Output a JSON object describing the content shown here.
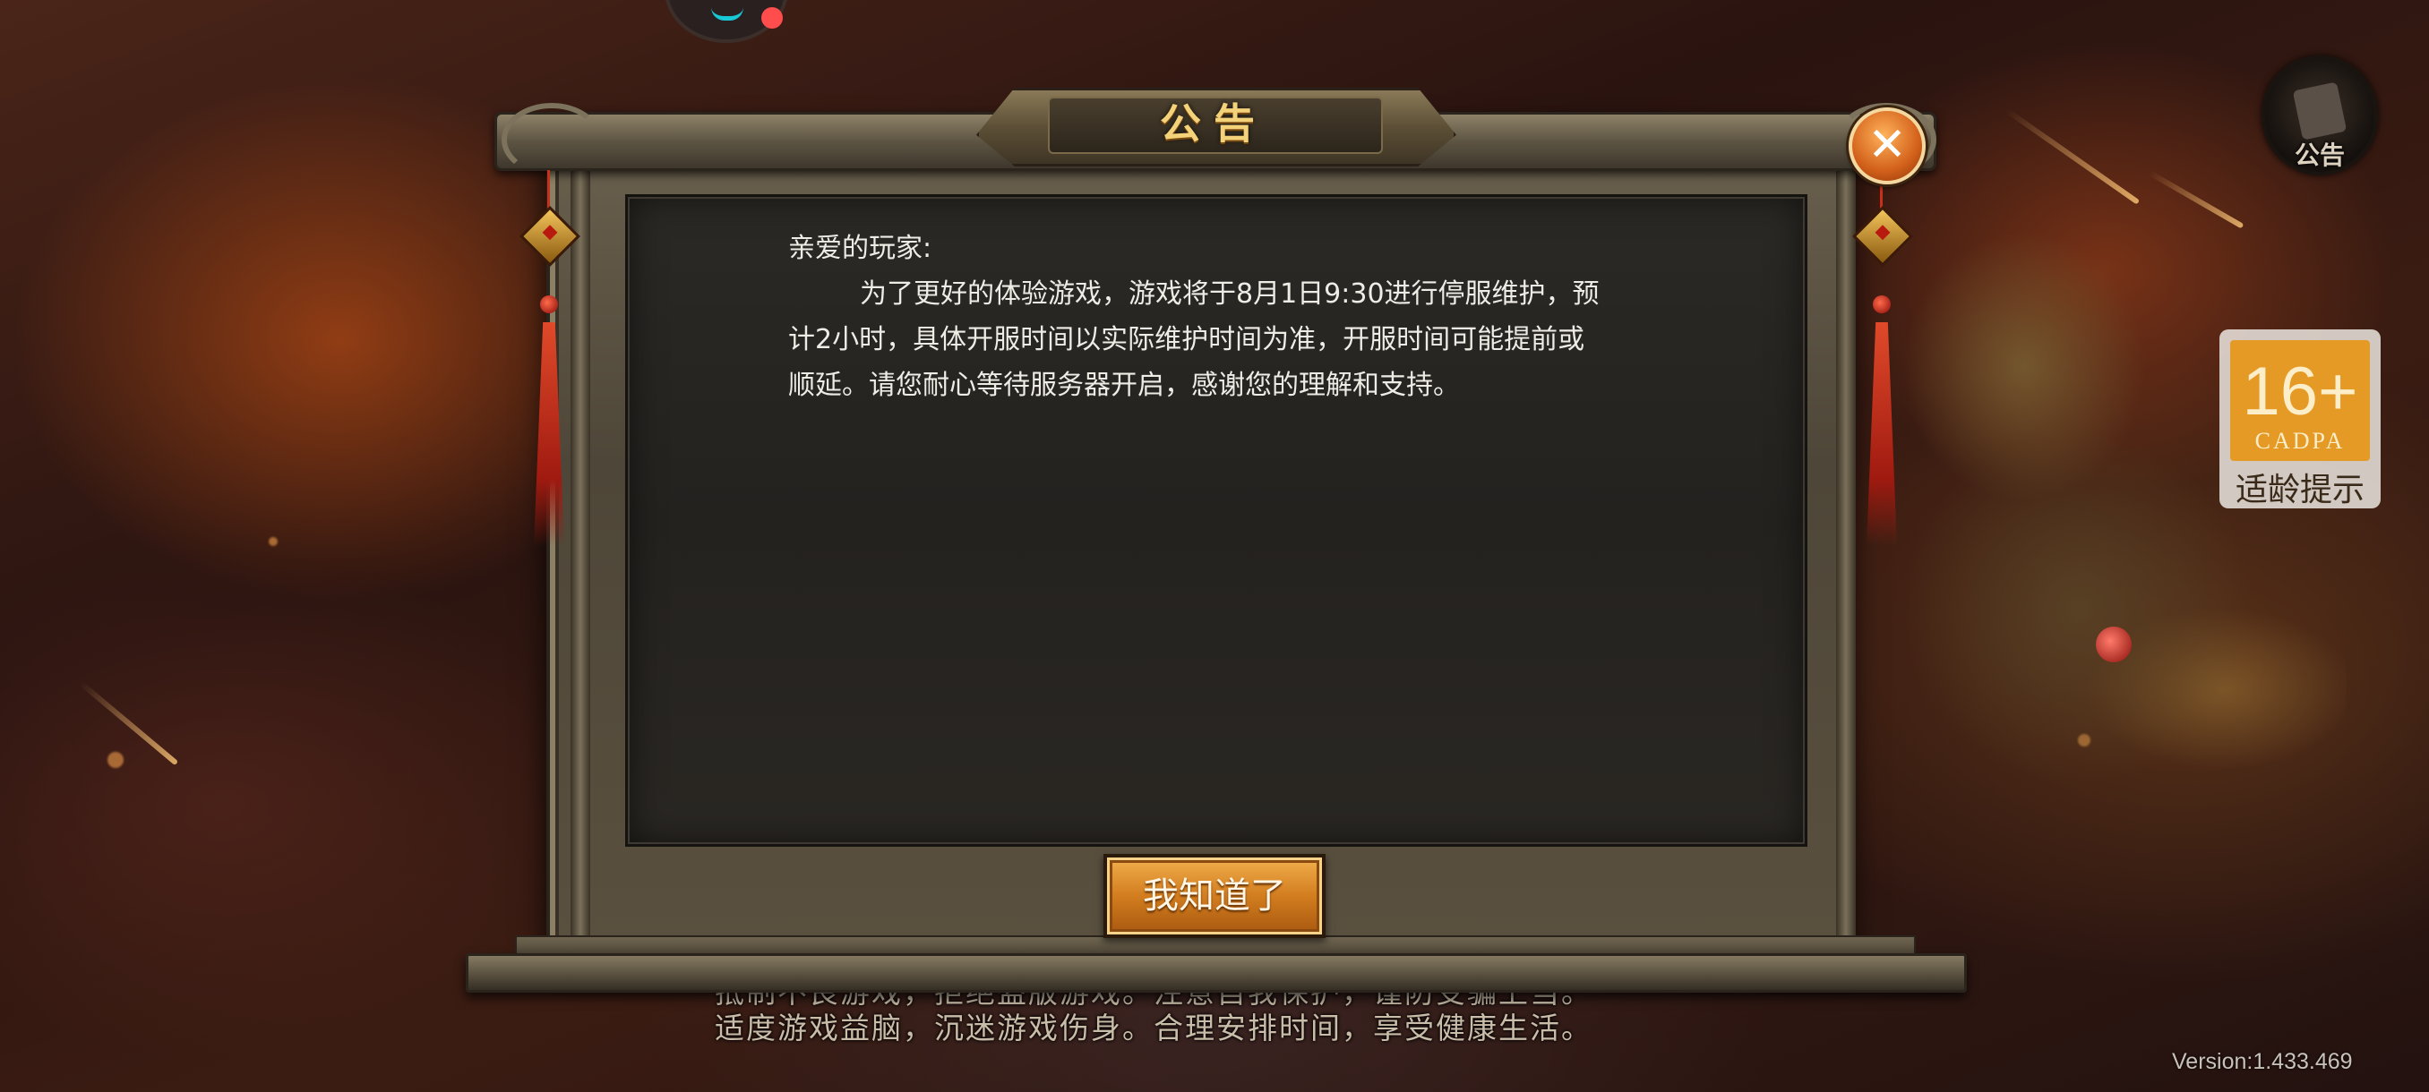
{
  "dialog": {
    "title": "公告",
    "greeting": "亲爱的玩家:",
    "body_line_1": "为了更好的体验游戏，游戏将于8月1日9:30进行停服维护，预",
    "body_line_2": "计2小时，具体开服时间以实际维护时间为准，开服时间可能提前或",
    "body_line_3": "顺延。请您耐心等待服务器开启，感谢您的理解和支持。",
    "confirm_label": "我知道了",
    "close_symbol": "✕"
  },
  "hud": {
    "notice_label": "公告",
    "age_rating": "16+",
    "age_org": "CADPA",
    "age_label": "适龄提示",
    "version": "Version:1.433.469"
  },
  "health_advice": {
    "line_1": "抵制不良游戏，拒绝盗版游戏。注意自我保护，谨防受骗上当。",
    "line_2": "适度游戏益脑，沉迷游戏伤身。合理安排时间，享受健康生活。"
  },
  "icons": {
    "close": "close-icon",
    "notice": "scroll-icon"
  },
  "colors": {
    "title_gold": "#f3d27a",
    "button_orange": "#d27d1f",
    "age_badge": "#e69a26",
    "status_dot": "#ff4d4d",
    "ring_accent": "#19c8d6"
  }
}
